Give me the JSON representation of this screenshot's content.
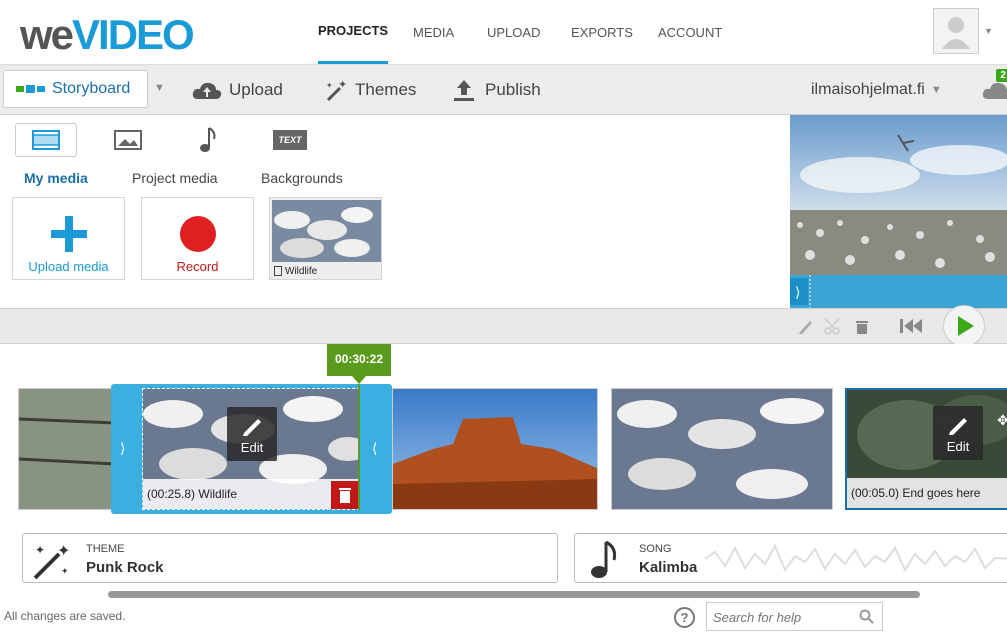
{
  "brand": {
    "logo_we": "we",
    "logo_video": "VIDEO"
  },
  "nav": {
    "projects": "PROJECTS",
    "media": "MEDIA",
    "upload": "UPLOAD",
    "exports": "EXPORTS",
    "account": "ACCOUNT"
  },
  "toolbar": {
    "storyboard": "Storyboard",
    "upload": "Upload",
    "themes": "Themes",
    "publish": "Publish",
    "account_name": "ilmaisohjelmat.fi",
    "badge": "2"
  },
  "library": {
    "tabs": [
      "video-tab",
      "image-tab",
      "audio-tab",
      "text-tab"
    ],
    "text_tab_label": "TEXT",
    "subtabs": {
      "my_media": "My media",
      "project_media": "Project media",
      "backgrounds": "Backgrounds"
    },
    "cards": {
      "upload_media": "Upload media",
      "record": "Record",
      "thumb_label": "Wildlife"
    }
  },
  "timeline": {
    "time_marker": "00:30:22",
    "clip1_caption": "(00:25.8) Wildlife",
    "clip_end_caption": "(00:05.0) End goes here",
    "edit_label": "Edit"
  },
  "theme": {
    "label": "THEME",
    "value": "Punk Rock"
  },
  "song": {
    "label": "SONG",
    "value": "Kalimba"
  },
  "footer": {
    "status": "All changes are saved.",
    "help_placeholder": "Search for help"
  },
  "colors": {
    "accent": "#1a9ad6",
    "selected_clip": "#3bb0e0",
    "marker": "#5a9a1c",
    "record": "#e02020",
    "play": "#3aa818"
  }
}
